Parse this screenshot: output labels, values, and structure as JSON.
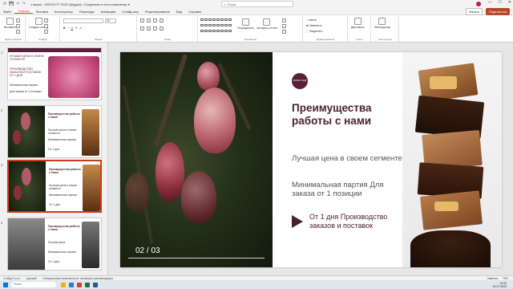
{
  "window": {
    "doc_title": "1 kaasa - 2023 В ПТ ПОЛ 2(Будич) • Сохранено в этот компьютер ▾",
    "search_placeholder": "Поиск",
    "share": "Поделиться",
    "record": "Запись",
    "minimize": "—",
    "maximize": "☐",
    "close": "✕"
  },
  "menu": {
    "tabs": [
      "Файл",
      "Главная",
      "Вставка",
      "Конструктор",
      "Переходы",
      "Анимация",
      "Слайд-шоу",
      "Рецензирование",
      "Вид",
      "Справка"
    ],
    "active": "Главная"
  },
  "ribbon": {
    "groups": [
      "Буфер обмена",
      "Слайды",
      "Шрифт",
      "Абзац",
      "Рисование",
      "Редактирование",
      "Голос",
      "Конструктор"
    ],
    "paste": "Вставить",
    "new_slide": "Создать слайд",
    "font_size": "30",
    "buttons": {
      "arrange": "Упорядочить",
      "quick_styles": "Экспресс-стили",
      "find": "Найти",
      "replace": "Заменить",
      "select": "Выделить",
      "dictate": "Диктовать",
      "designer": "Конструктор"
    }
  },
  "thumbnails": [
    {
      "num": "1",
      "lines": [
        "ЛУЧШАЯ ЦЕНА В СВОЕМ СЕГМЕНТЕ",
        "ПРОИЗВОДСТВО ЗАКАЗОВ И ПОСТАВОК ОТ 1 ДНЯ",
        "Минимальная партия",
        "Для заказа от 1 позиции"
      ]
    },
    {
      "num": "2",
      "title": "Преимущества работы с нами",
      "lines": [
        "Лучшая цена в своем сегменте",
        "Минимальная партия",
        "От 1 дня"
      ]
    },
    {
      "num": "3",
      "title": "Преимущества работы с нами",
      "lines": [
        "Лучшая цена в своем сегменте",
        "Минимальная партия",
        "От 1 дня"
      ]
    },
    {
      "num": "4",
      "title": "Преимущества работы с нами",
      "lines": [
        "Лучшая цена",
        "Минимальная партия",
        "От 1 дня"
      ]
    }
  ],
  "slide": {
    "page_num": "02 / 03",
    "logo_text": "ШОКО ЛАД",
    "title": "Преимущества работы с нами",
    "point1": "Лучшая цена в своем сегменте",
    "point2": "Минимальная партия Для заказа от 1 позиции",
    "point3": "От 1 дня Производство заказов и  поставок"
  },
  "status": {
    "slide_info": "Слайд 2 из 4",
    "language": "русский",
    "accessibility": "Специальные возможности: проверьте рекомендации",
    "notes": "Заметки",
    "zoom": "73%"
  },
  "taskbar": {
    "search": "Поиск",
    "time": "11:02",
    "date": "24.07.2023"
  },
  "colors": {
    "accent": "#b7472a",
    "slide_title": "#4a1f2e",
    "logo_bg": "#5a1f3a"
  }
}
